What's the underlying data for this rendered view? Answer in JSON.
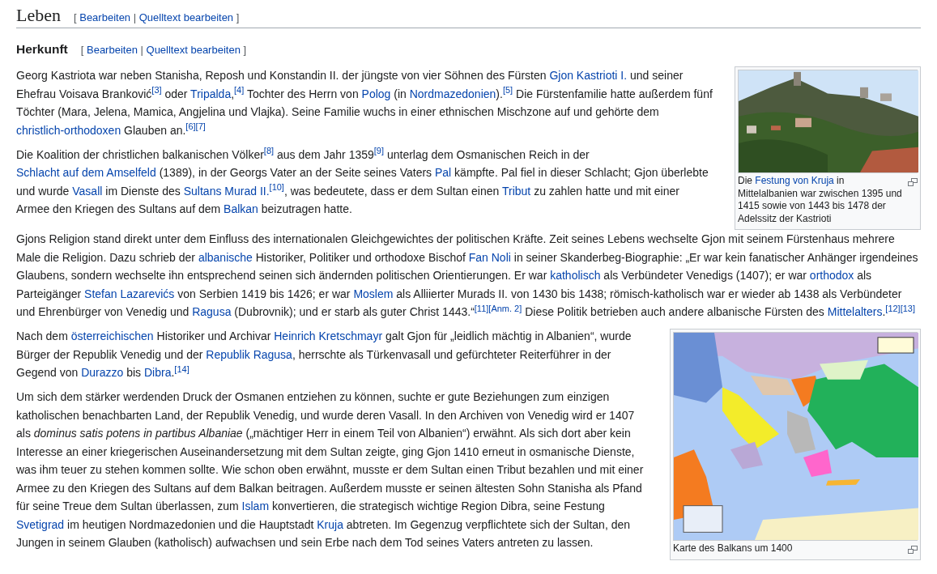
{
  "section": {
    "title": "Leben",
    "edit_links": {
      "open": "[",
      "separator": "|",
      "close": "]",
      "items": [
        "Bearbeiten",
        "Quelltext bearbeiten"
      ]
    }
  },
  "subsection": {
    "title": "Herkunft",
    "edit_links": {
      "open": "[",
      "separator": "|",
      "close": "]",
      "items": [
        "Bearbeiten",
        "Quelltext bearbeiten"
      ]
    }
  },
  "blocks": [
    {
      "figure": {
        "caption": [
          {
            "kind": "text",
            "text": "Die "
          },
          {
            "kind": "link",
            "text": "Festung von Kruja"
          },
          {
            "kind": "text",
            "text": " in Mittelalbanien war zwischen 1395 und 1415 sowie von 1443 bis 1478 der Adelssitz der Kastrioti"
          }
        ]
      },
      "paragraphs": [
        [
          {
            "kind": "text",
            "text": "Georg Kastriota war neben Stanisha, Reposh und Konstandin II. der jüngste von vier Söhnen des Fürsten "
          },
          {
            "kind": "link",
            "text": "Gjon Kastrioti I."
          },
          {
            "kind": "text",
            "text": " und seiner Ehefrau Voisava Branković"
          },
          {
            "kind": "ref",
            "text": "[3]"
          },
          {
            "kind": "text",
            "text": " oder "
          },
          {
            "kind": "link",
            "text": "Tripalda"
          },
          {
            "kind": "text",
            "text": ","
          },
          {
            "kind": "ref",
            "text": "[4]"
          },
          {
            "kind": "text",
            "text": " Tochter des Herrn von "
          },
          {
            "kind": "link",
            "text": "Polog"
          },
          {
            "kind": "text",
            "text": " (in "
          },
          {
            "kind": "link",
            "text": "Nordmazedonien"
          },
          {
            "kind": "text",
            "text": ")."
          },
          {
            "kind": "ref",
            "text": "[5]"
          },
          {
            "kind": "text",
            "text": " Die Fürstenfamilie hatte außerdem fünf Töchter (Mara, Jelena, Mamica, Angjelina und Vlajka). Seine Familie wuchs in einer ethnischen Mischzone auf und gehörte dem "
          },
          {
            "kind": "link",
            "text": "christlich-orthodoxen"
          },
          {
            "kind": "text",
            "text": " Glauben an."
          },
          {
            "kind": "ref",
            "text": "[6]"
          },
          {
            "kind": "ref",
            "text": "[7]"
          }
        ],
        [
          {
            "kind": "text",
            "text": "Die Koalition der christlichen balkanischen Völker"
          },
          {
            "kind": "ref",
            "text": "[8]"
          },
          {
            "kind": "text",
            "text": " aus dem Jahr 1359"
          },
          {
            "kind": "ref",
            "text": "[9]"
          },
          {
            "kind": "text",
            "text": " unterlag dem Osmanischen Reich in der "
          },
          {
            "kind": "link",
            "text": "Schlacht auf dem Amselfeld"
          },
          {
            "kind": "text",
            "text": " (1389), in der Georgs Vater an der Seite seines Vaters "
          },
          {
            "kind": "link",
            "text": "Pal"
          },
          {
            "kind": "text",
            "text": " kämpfte. Pal fiel in dieser Schlacht; Gjon überlebte und wurde "
          },
          {
            "kind": "link",
            "text": "Vasall"
          },
          {
            "kind": "text",
            "text": " im Dienste des "
          },
          {
            "kind": "link",
            "text": "Sultans Murad II."
          },
          {
            "kind": "ref",
            "text": "[10]"
          },
          {
            "kind": "text",
            "text": ", was bedeutete, dass er dem Sultan einen "
          },
          {
            "kind": "link",
            "text": "Tribut"
          },
          {
            "kind": "text",
            "text": " zu zahlen hatte und mit einer Armee den Kriegen des Sultans auf dem "
          },
          {
            "kind": "link",
            "text": "Balkan"
          },
          {
            "kind": "text",
            "text": " beizutragen hatte."
          }
        ]
      ]
    },
    {
      "paragraphs": [
        [
          {
            "kind": "text",
            "text": "Gjons Religion stand direkt unter dem Einfluss des internationalen Gleichgewichtes der politischen Kräfte. Zeit seines Lebens wechselte Gjon mit seinem Fürstenhaus mehrere Male die Religion. Dazu schrieb der "
          },
          {
            "kind": "link",
            "text": "albanische"
          },
          {
            "kind": "text",
            "text": " Historiker, Politiker und orthodoxe Bischof "
          },
          {
            "kind": "link",
            "text": "Fan Noli"
          },
          {
            "kind": "text",
            "text": " in seiner Skanderbeg-Biographie: „Er war kein fanatischer Anhänger irgendeines Glaubens, sondern wechselte ihn entsprechend seinen sich ändernden politischen Orientierungen. Er war "
          },
          {
            "kind": "link",
            "text": "katholisch"
          },
          {
            "kind": "text",
            "text": " als Verbündeter Venedigs (1407); er war "
          },
          {
            "kind": "link",
            "text": "orthodox"
          },
          {
            "kind": "text",
            "text": " als Parteigänger "
          },
          {
            "kind": "link",
            "text": "Stefan Lazarevićs"
          },
          {
            "kind": "text",
            "text": " von Serbien 1419 bis 1426; er war "
          },
          {
            "kind": "link",
            "text": "Moslem"
          },
          {
            "kind": "text",
            "text": " als Alliierter Murads II. von 1430 bis 1438; römisch-katholisch war er wieder ab 1438 als Verbündeter und Ehrenbürger von Venedig und "
          },
          {
            "kind": "link",
            "text": "Ragusa"
          },
          {
            "kind": "text",
            "text": " (Dubrovnik); und er starb als guter Christ 1443.“"
          },
          {
            "kind": "ref",
            "text": "[11]"
          },
          {
            "kind": "ref",
            "text": "[Anm. 2]"
          },
          {
            "kind": "text",
            "text": " Diese Politik betrieben auch andere albanische Fürsten des "
          },
          {
            "kind": "link",
            "text": "Mittelalters"
          },
          {
            "kind": "text",
            "text": "."
          },
          {
            "kind": "ref",
            "text": "[12]"
          },
          {
            "kind": "ref",
            "text": "[13]"
          }
        ]
      ]
    },
    {
      "figure": {
        "kind": "map",
        "caption": [
          {
            "kind": "text",
            "text": "Karte des Balkans um 1400"
          }
        ]
      },
      "paragraphs": [
        [
          {
            "kind": "text",
            "text": "Nach dem "
          },
          {
            "kind": "link",
            "text": "österreichischen"
          },
          {
            "kind": "text",
            "text": " Historiker und Archivar "
          },
          {
            "kind": "link",
            "text": "Heinrich Kretschmayr"
          },
          {
            "kind": "text",
            "text": " galt Gjon für „leidlich mächtig in Albanien“, wurde Bürger der Republik Venedig und der "
          },
          {
            "kind": "link",
            "text": "Republik Ragusa"
          },
          {
            "kind": "text",
            "text": ", herrschte als Türkenvasall und gefürchteter Reiterführer in der Gegend von "
          },
          {
            "kind": "link",
            "text": "Durazzo"
          },
          {
            "kind": "text",
            "text": " bis "
          },
          {
            "kind": "link",
            "text": "Dibra"
          },
          {
            "kind": "text",
            "text": "."
          },
          {
            "kind": "ref",
            "text": "[14]"
          }
        ],
        [
          {
            "kind": "text",
            "text": "Um sich dem stärker werdenden Druck der Osmanen entziehen zu können, suchte er gute Beziehungen zum einzigen katholischen benachbarten Land, der Republik Venedig, und wurde deren Vasall. In den Archiven von Venedig wird er 1407 als "
          },
          {
            "kind": "italic",
            "text": "dominus satis potens in partibus Albaniae"
          },
          {
            "kind": "text",
            "text": " („mächtiger Herr in einem Teil von Albanien“) erwähnt. Als sich dort aber kein Interesse an einer kriegerischen Auseinandersetzung mit dem Sultan zeigte, ging Gjon 1410 erneut in osmanische Dienste, was ihm teuer zu stehen kommen sollte. Wie schon oben erwähnt, musste er dem Sultan einen Tribut bezahlen und mit einer Armee zu den Kriegen des Sultans auf dem Balkan beitragen. Außerdem musste er seinen ältesten Sohn Stanisha als Pfand für seine Treue dem Sultan überlassen, zum "
          },
          {
            "kind": "link",
            "text": "Islam"
          },
          {
            "kind": "text",
            "text": " konvertieren, die strategisch wichtige Region Dibra, seine Festung "
          },
          {
            "kind": "link",
            "text": "Svetigrad"
          },
          {
            "kind": "text",
            "text": " im heutigen Nordmazedonien und die Hauptstadt "
          },
          {
            "kind": "link",
            "text": "Kruja"
          },
          {
            "kind": "text",
            "text": " abtreten. Im Gegenzug verpflichtete sich der Sultan, den Jungen in seinem Glauben (katholisch) aufwachsen und sein Erbe nach dem Tod seines Vaters antreten zu lassen."
          }
        ]
      ]
    }
  ]
}
